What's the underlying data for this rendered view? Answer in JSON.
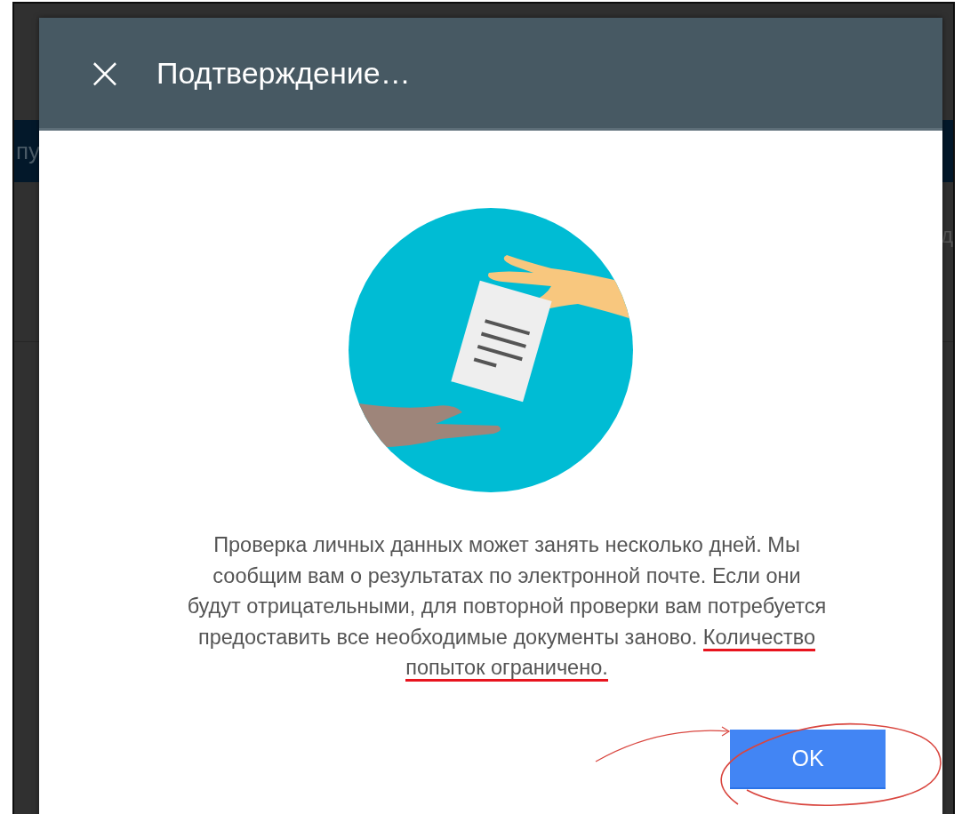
{
  "background": {
    "nav_left": "пу",
    "side_right": "д"
  },
  "dialog": {
    "title": "Подтверждение…",
    "close": "×",
    "message": [
      [
        {
          "text": "Проверка личных данных может занять несколько дней. Мы",
          "underlined": false
        }
      ],
      [
        {
          "text": "сообщим вам о результатах по электронной почте. Если они",
          "underlined": false
        }
      ],
      [
        {
          "text": "будут отрицательными, для повторной проверки вам потребуется",
          "underlined": false
        }
      ],
      [
        {
          "text": "предоставить все необходимые документы заново. ",
          "underlined": false
        },
        {
          "text": "Количество",
          "underlined": true
        }
      ],
      [
        {
          "text": "попыток ограничено.",
          "underlined": true
        }
      ]
    ],
    "buttons": [
      {
        "label": "OK",
        "kind": "primary"
      }
    ]
  }
}
